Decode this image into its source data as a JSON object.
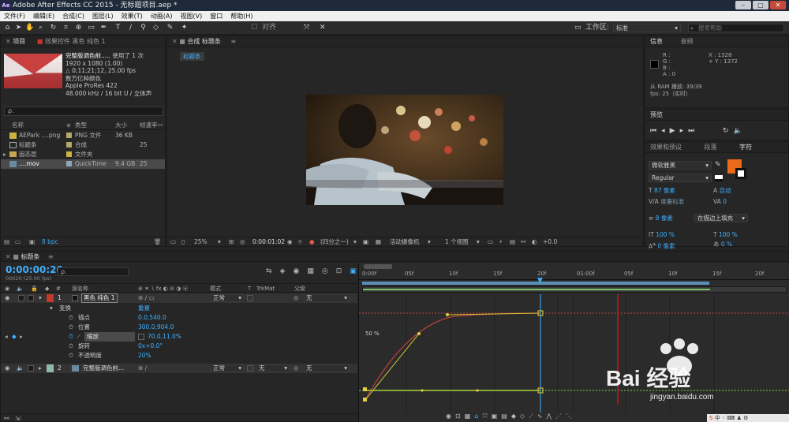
{
  "window": {
    "title": "Adobe After Effects CC 2015 - 无标题项目.aep *",
    "logo": "Ae",
    "buttons": [
      "–",
      "□",
      "✕"
    ]
  },
  "menu": [
    "文件(F)",
    "编辑(E)",
    "合成(C)",
    "图层(L)",
    "效果(T)",
    "动画(A)",
    "视图(V)",
    "窗口",
    "帮助(H)"
  ],
  "toolbar": {
    "snap_label": "对齐",
    "workspace_label": "工作区:",
    "workspace_value": "标准",
    "search_placeholder": "搜索帮助"
  },
  "project": {
    "tab_project": "项目",
    "tab_effects": "效果控件 黑色 纯色 1",
    "item_name": "完整版调色前....",
    "item_used": ", 使用了 1 次",
    "item_size": "1920 x 1080 (1.00)",
    "item_duration": "△ 0;11;21;12, 25.00 fps",
    "item_colors": "数万亿种颜色",
    "item_codec": "Apple ProRes 422",
    "item_audio": "48.000 kHz / 16 bit U / 立体声",
    "search_placeholder": "ρ.",
    "columns": [
      "名称",
      "类型",
      "大小",
      "帧速率"
    ],
    "rows": [
      {
        "name": "AEPark ....png",
        "type": "PNG 文件",
        "size": "36 KB",
        "fps": "",
        "color": "#b3a86a"
      },
      {
        "name": "标题条",
        "type": "合成",
        "size": "",
        "fps": "25",
        "color": "#b3a86a"
      },
      {
        "name": "固态层",
        "type": "文件夹",
        "size": "",
        "fps": "",
        "color": "#c9b440"
      },
      {
        "name": "....mov",
        "type": "QuickTime",
        "size": "9.4 GB",
        "fps": "25",
        "color": "#8fa9b8"
      }
    ],
    "bpc": "8 bpc"
  },
  "composition": {
    "tab_label": "合成 标题条",
    "breadcrumb": "标题条",
    "zoom": "25%",
    "timecode": "0:00:01:02",
    "resolution": "(四分之一)",
    "camera": "活动摄像机",
    "views": "1 个视图",
    "offset": "+0.0"
  },
  "info": {
    "tab_info": "信息",
    "tab_audio": "音频",
    "r": "R :",
    "g": "G :",
    "b": "B :",
    "a": "A : 0",
    "x": "X : 1328",
    "y": "+ Y : 1372",
    "ram": "从 RAM 播放: 39/39",
    "fps": "fps: 25（实时）"
  },
  "preview": {
    "tab": "预览"
  },
  "character": {
    "tab_effects": "效果和预设",
    "tab_paragraph": "段落",
    "tab_character": "字符",
    "font": "微软雅黑",
    "style": "Regular",
    "size": "87 像素",
    "leading": "自动",
    "kerning": "度量标准",
    "tracking": "0",
    "stroke": "8 像素",
    "stroke_mode": "在描边上填充",
    "vscale": "100 %",
    "hscale": "100 %",
    "baseline": "0 像素",
    "tsume": "0 %",
    "fill_color": "#e86a1a"
  },
  "timeline": {
    "tab": "标题条",
    "timecode": "0:00:00:20",
    "frame_info": "00020 (25.00 fps)",
    "columns": [
      "源名称",
      "模式",
      "T",
      "TrkMat",
      "父级"
    ],
    "layer1": {
      "num": "1",
      "name": "黑色 纯色 1",
      "mode": "正常",
      "parent": "无",
      "color": "#c0392b"
    },
    "transform": "变换",
    "reset": "重置",
    "props": [
      {
        "label": "锚点",
        "value": "0.0,540.0"
      },
      {
        "label": "位置",
        "value": "300.0,904.0"
      },
      {
        "label": "缩放",
        "value": "70.0,11.0%"
      },
      {
        "label": "旋转",
        "value": "0x+0.0°"
      },
      {
        "label": "不透明度",
        "value": "20%"
      }
    ],
    "layer2": {
      "num": "2",
      "name": "完整版调色前...",
      "mode": "正常",
      "trkmat": "无",
      "parent": "无",
      "color": "#8fb8b0"
    },
    "ruler": [
      "0:00f",
      "05f",
      "10f",
      "15f",
      "20f",
      "01:00f",
      "05f",
      "10f",
      "15f",
      "20f"
    ],
    "graph_label": "50 %"
  },
  "watermark": {
    "brand": "Bai 经验",
    "url": "jingyan.baidu.com"
  }
}
